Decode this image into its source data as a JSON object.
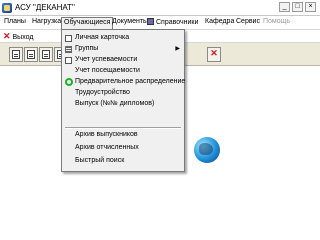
{
  "window": {
    "title": "АСУ \"ДЕКАНАТ\"",
    "minimize_glyph": "_",
    "maximize_glyph": "□",
    "close_glyph": "×"
  },
  "menubar": {
    "items": [
      {
        "label": "Планы",
        "state": "normal"
      },
      {
        "label": "Нагрузка",
        "state": "normal"
      },
      {
        "label": "Обучающиеся",
        "state": "open"
      },
      {
        "label": "Документы",
        "state": "normal"
      },
      {
        "label": "Справочники",
        "state": "normal",
        "icon": "reference-book-icon"
      },
      {
        "label": "Кафедра",
        "state": "normal"
      },
      {
        "label": "Сервис",
        "state": "normal"
      },
      {
        "label": "Помощь",
        "state": "disabled"
      }
    ]
  },
  "exitbar": {
    "label": "Выход",
    "icon": "close-x-icon",
    "icon_glyph": "✕"
  },
  "toolbar": {
    "buttons": [
      "document-icon",
      "document-icon",
      "document-icon",
      "document-icon",
      "document-icon",
      "document-icon"
    ],
    "close_glyph": "✕"
  },
  "dropdown": {
    "items": [
      {
        "label": "Личная карточка",
        "icon": "document-icon"
      },
      {
        "label": "Группы",
        "icon": "grid-icon",
        "submenu_glyph": "▶"
      },
      {
        "label": "Учет успеваемости",
        "icon": "document-icon"
      },
      {
        "label": "Учет посещаемости",
        "icon": ""
      },
      {
        "label": "Предварительное распределение",
        "icon": "green-circle-icon"
      },
      {
        "label": "Трудоустройство",
        "icon": ""
      },
      {
        "label": "Выпуск (№№ дипломов)",
        "icon": ""
      },
      {
        "label": "Архив выпускников",
        "icon": ""
      },
      {
        "label": "Архив отчисленных",
        "icon": ""
      },
      {
        "label": "Быстрый поиск",
        "icon": ""
      }
    ]
  },
  "colors": {
    "accent_red": "#d11a1a",
    "green": "#1bb325",
    "globe": "#1f8fd8"
  }
}
